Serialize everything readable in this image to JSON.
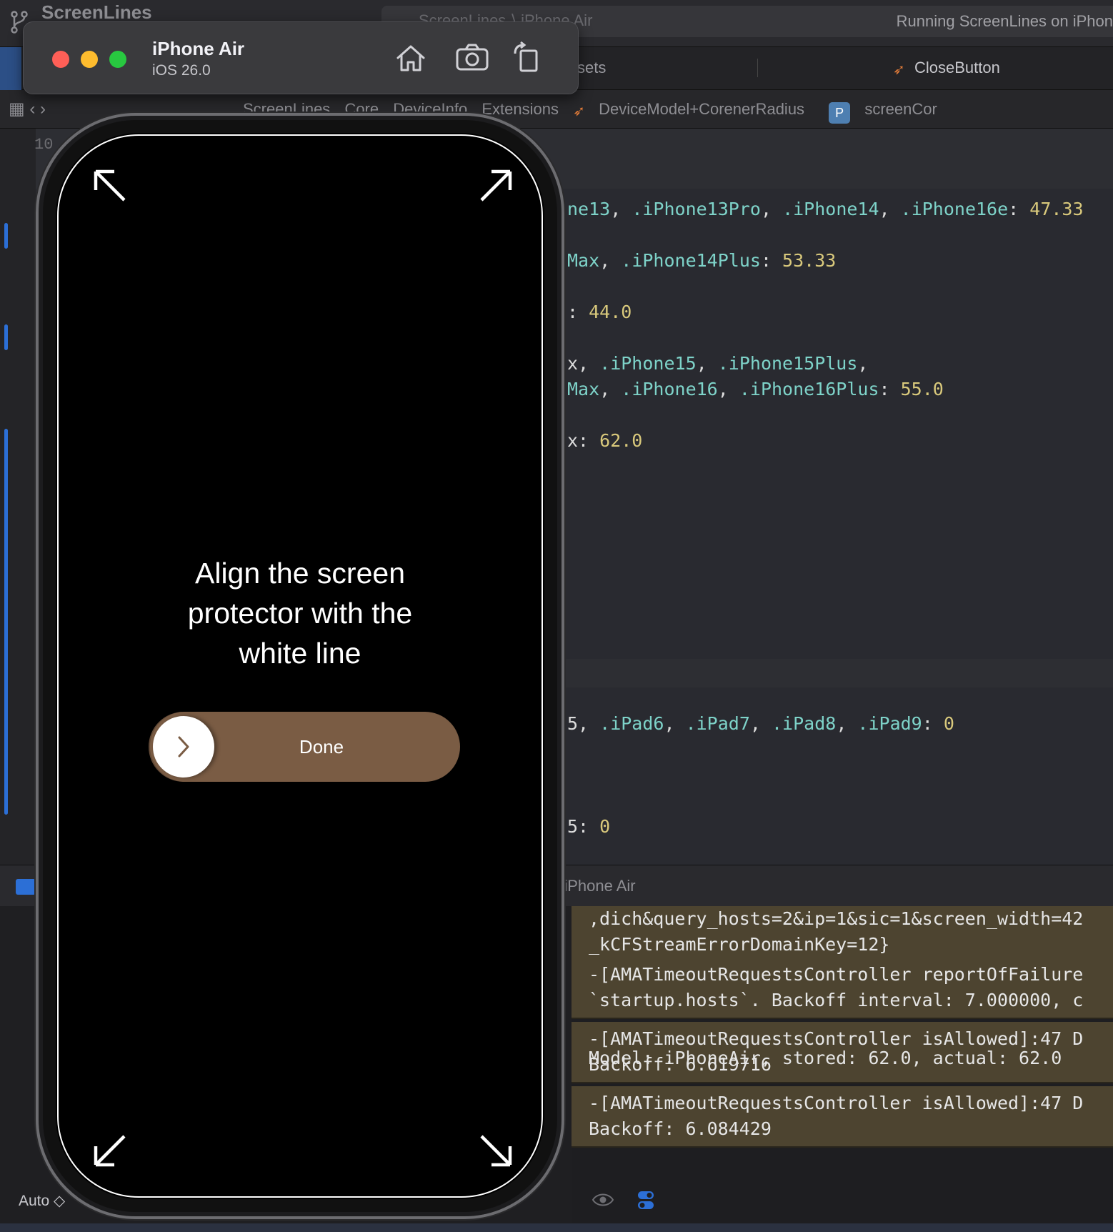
{
  "xcode": {
    "project_name": "ScreenLines",
    "scheme": "ScreenLines ⟩ iPhone Air",
    "run_status": "Running ScreenLines on iPhon",
    "tabs": {
      "assets_fragment": "sets",
      "close_button_tab": "CloseButton"
    },
    "breadcrumbs": [
      "ScreenLines",
      "ScreenLines",
      "Core",
      "DeviceInfo",
      "Extensions",
      "DeviceModel+CorenerRadius",
      "screenCor"
    ],
    "line_numbers": [
      "10"
    ],
    "code_lines": [
      {
        "fragments": [
          {
            "t": "ne13",
            "c": "id"
          },
          {
            "t": ", ",
            "c": "plain"
          },
          {
            "t": ".iPhone13Pro",
            "c": "id"
          },
          {
            "t": ", ",
            "c": "plain"
          },
          {
            "t": ".iPhone14",
            "c": "id"
          },
          {
            "t": ", ",
            "c": "plain"
          },
          {
            "t": ".iPhone16e",
            "c": "id"
          },
          {
            "t": ": ",
            "c": "plain"
          },
          {
            "t": "47.33",
            "c": "num"
          }
        ]
      },
      {
        "fragments": [
          {
            "t": "Max",
            "c": "id"
          },
          {
            "t": ", ",
            "c": "plain"
          },
          {
            "t": ".iPhone14Plus",
            "c": "id"
          },
          {
            "t": ": ",
            "c": "plain"
          },
          {
            "t": "53.33",
            "c": "num"
          }
        ]
      },
      {
        "fragments": [
          {
            "t": ": ",
            "c": "plain"
          },
          {
            "t": "44.0",
            "c": "num"
          }
        ]
      },
      {
        "fragments": [
          {
            "t": "x, ",
            "c": "plain"
          },
          {
            "t": ".iPhone15",
            "c": "id"
          },
          {
            "t": ", ",
            "c": "plain"
          },
          {
            "t": ".iPhone15Plus",
            "c": "id"
          },
          {
            "t": ",",
            "c": "plain"
          }
        ]
      },
      {
        "fragments": [
          {
            "t": "Max",
            "c": "id"
          },
          {
            "t": ", ",
            "c": "plain"
          },
          {
            "t": ".iPhone16",
            "c": "id"
          },
          {
            "t": ", ",
            "c": "plain"
          },
          {
            "t": ".iPhone16Plus",
            "c": "id"
          },
          {
            "t": ": ",
            "c": "plain"
          },
          {
            "t": "55.0",
            "c": "num"
          }
        ]
      },
      {
        "fragments": [
          {
            "t": "x: ",
            "c": "plain"
          },
          {
            "t": "62.0",
            "c": "num"
          }
        ]
      },
      {
        "fragments": [
          {
            "t": "5, ",
            "c": "plain"
          },
          {
            "t": ".iPad6",
            "c": "id"
          },
          {
            "t": ", ",
            "c": "plain"
          },
          {
            "t": ".iPad7",
            "c": "id"
          },
          {
            "t": ", ",
            "c": "plain"
          },
          {
            "t": ".iPad8",
            "c": "id"
          },
          {
            "t": ", ",
            "c": "plain"
          },
          {
            "t": ".iPad9",
            "c": "id"
          },
          {
            "t": ": ",
            "c": "plain"
          },
          {
            "t": "0",
            "c": "num"
          }
        ]
      },
      {
        "fragments": [
          {
            "t": "5: ",
            "c": "plain"
          },
          {
            "t": "0",
            "c": "num"
          }
        ]
      }
    ],
    "console_title": "s : iPhone Air",
    "variables_scope": "Auto ◇",
    "console_logs": [
      {
        "lines": [
          ",dich&query_hosts=2&ip=1&sic=1&screen_width=42",
          "_kCFStreamErrorDomainKey=12}"
        ]
      },
      {
        "lines": [
          "-[AMATimeoutRequestsController reportOfFailure",
          "`startup.hosts`. Backoff interval: 7.000000, c"
        ]
      },
      {
        "lines": [
          "-[AMATimeoutRequestsController isAllowed]:47 D",
          "Backoff: 6.619716"
        ]
      },
      {
        "lines": [
          "-[AMATimeoutRequestsController isAllowed]:47 D",
          "Backoff: 6.084429"
        ]
      }
    ],
    "console_plain": "Model: iPhoneAir, stored: 62.0, actual: 62.0"
  },
  "simulator": {
    "device_name": "iPhone Air",
    "os_version": "iOS 26.0",
    "instruction": [
      "Align the screen",
      "protector with the",
      "white line"
    ],
    "done_label": "Done",
    "slider_color": "#7a5c44"
  }
}
